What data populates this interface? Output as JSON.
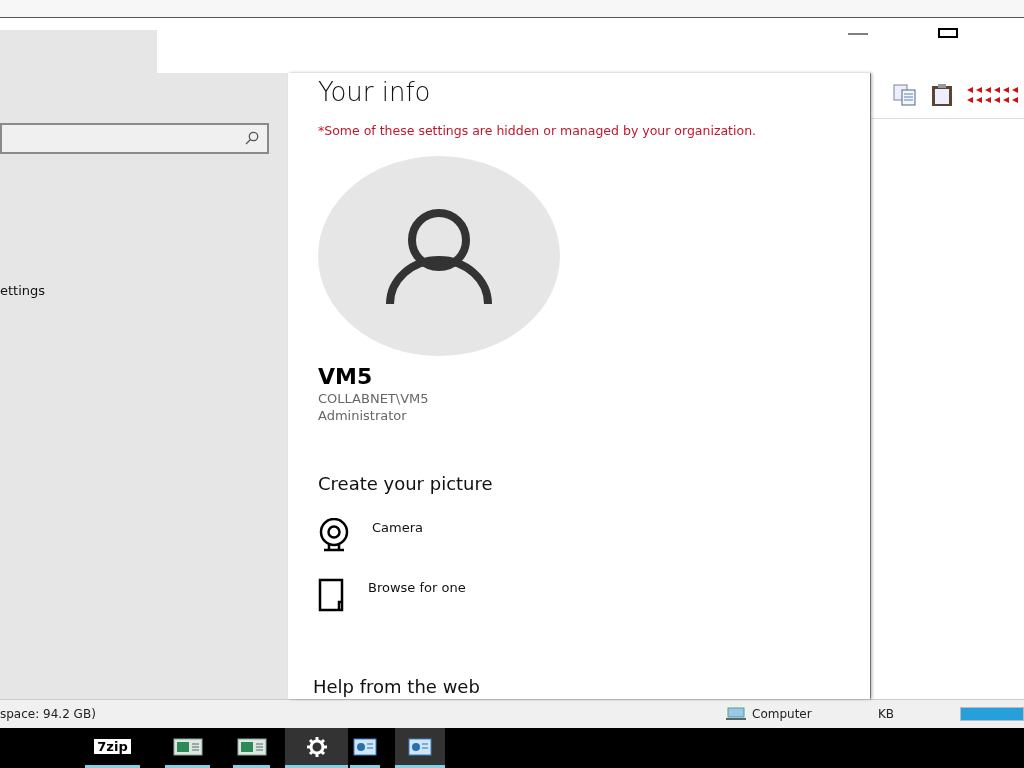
{
  "settings_window": {
    "nav": {
      "items": [
        {
          "label": "ettings"
        }
      ]
    },
    "content": {
      "title": "Your info",
      "notice": "*Some of these settings are hidden or managed by your organization.",
      "account": {
        "name": "VM5",
        "domain": "COLLABNET\\VM5",
        "role": "Administrator"
      },
      "picture_section": {
        "heading": "Create your picture",
        "options": [
          {
            "kind": "camera",
            "label": "Camera"
          },
          {
            "kind": "browse",
            "label": "Browse for one"
          }
        ]
      },
      "help_heading": "Help from the web"
    }
  },
  "explorer_status": {
    "left_text": "space: 94.2 GB)",
    "location": "Computer",
    "size": "KB",
    "capacity": {
      "level": 1
    }
  },
  "taskbar": {
    "items": [
      {
        "kind": "logo",
        "label": "7zip",
        "selected": false
      },
      {
        "kind": "window",
        "selected": false
      },
      {
        "kind": "window",
        "selected": false
      },
      {
        "kind": "gear",
        "selected": true
      },
      {
        "kind": "chart",
        "selected": false
      },
      {
        "kind": "chart",
        "selected": true
      }
    ]
  }
}
